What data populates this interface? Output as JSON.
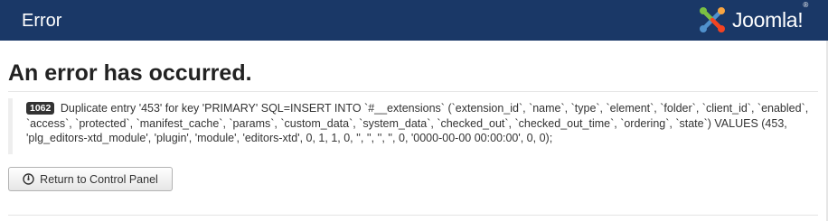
{
  "header": {
    "title": "Error",
    "brand_name": "Joomla!",
    "brand_reg": "®",
    "background_color": "#1a3867"
  },
  "main": {
    "heading": "An error has occurred.",
    "error_code": "1062",
    "error_message": "Duplicate entry '453' for key 'PRIMARY' SQL=INSERT INTO `#__extensions` (`extension_id`, `name`, `type`, `element`, `folder`, `client_id`, `enabled`, `access`, `protected`, `manifest_cache`, `params`, `custom_data`, `system_data`, `checked_out`, `checked_out_time`, `ordering`, `state`) VALUES (453, 'plg_editors-xtd_module', 'plugin', 'module', 'editors-xtd', 0, 1, 1, 0, '', '', '', '', 0, '0000-00-00 00:00:00', 0, 0);",
    "return_button_label": "Return to Control Panel",
    "return_button_icon": "dashboard-icon"
  },
  "brand_colors": {
    "logo_green": "#7ac143",
    "logo_orange": "#f9a541",
    "logo_red": "#f44321",
    "logo_blue": "#5091cd",
    "error_badge": "#333333"
  }
}
